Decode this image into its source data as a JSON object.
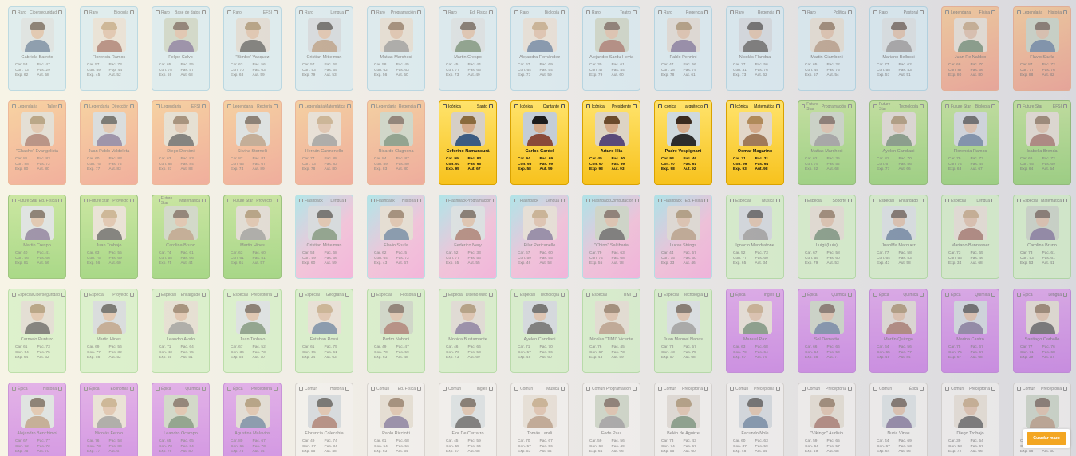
{
  "save_button": "Guardar mazo",
  "cards": [
    {
      "rarity": "Raro",
      "subject": "Ciberseguridad",
      "name": "Gabriela Barreto",
      "stats": [
        "Car. 53",
        "Pac. 47",
        "Con. 73",
        "Pas. 29",
        "Exp. 62",
        "Aut. 58"
      ]
    },
    {
      "rarity": "Raro",
      "subject": "Biología",
      "name": "Florencia Ramos",
      "stats": [
        "Car. 57",
        "Pac. 73",
        "Con. 59",
        "Pop. 44",
        "Exp. 45",
        "Aut. 52"
      ]
    },
    {
      "rarity": "Raro",
      "subject": "Base de datos",
      "name": "Felipe Calvo",
      "stats": [
        "Car. 65",
        "Pac. 55",
        "Con. 75",
        "Pas. 57",
        "Exp. 59",
        "Aut. 68"
      ]
    },
    {
      "rarity": "Raro",
      "subject": "EFSI",
      "name": "\"Bimbo\" Vasquez",
      "stats": [
        "Car. 63",
        "Pac. 56",
        "Con. 70",
        "Pas. 63",
        "Exp. 68",
        "Aut. 59"
      ]
    },
    {
      "rarity": "Raro",
      "subject": "Lengua",
      "name": "Cristian Mittelman",
      "stats": [
        "Car. 57",
        "Pac. 69",
        "Con. 53",
        "Pas. 65",
        "Exp. 79",
        "Aut. 53"
      ]
    },
    {
      "rarity": "Raro",
      "subject": "Programación",
      "name": "Matias Marchesi",
      "stats": [
        "Car. 58",
        "Pac. 45",
        "Con. 62",
        "Pas. 63",
        "Exp. 56",
        "Aut. 50"
      ]
    },
    {
      "rarity": "Raro",
      "subject": "Ed. Física",
      "name": "Martin Crespo",
      "stats": [
        "Car. 45",
        "Pac. 44",
        "Con. 77",
        "Pas. 65",
        "Exp. 73",
        "Aut. 49"
      ]
    },
    {
      "rarity": "Raro",
      "subject": "Biología",
      "name": "Alejandra Fernández",
      "stats": [
        "Car. 67",
        "Pac. 69",
        "Con. 64",
        "Pas. 54",
        "Exp. 73",
        "Aut. 59"
      ]
    },
    {
      "rarity": "Raro",
      "subject": "Teatro",
      "name": "Alejandro Sardu Hevia",
      "stats": [
        "Car. 30",
        "Pac. 61",
        "Con. 47",
        "Pas. 44",
        "Exp. 79",
        "Aut. 60"
      ]
    },
    {
      "rarity": "Raro",
      "subject": "Regencia",
      "name": "Pablo Pennini",
      "stats": [
        "Car. 47",
        "Pac. 56",
        "Con. 28",
        "Pas. 74",
        "Exp. 78",
        "Aut. 61"
      ]
    },
    {
      "rarity": "Raro",
      "subject": "Regencia",
      "name": "Nicolás Flandua",
      "stats": [
        "Car. 27",
        "Pac. 56",
        "Con. 31",
        "Pas. 76",
        "Exp. 73",
        "Aut. 62"
      ]
    },
    {
      "rarity": "Raro",
      "subject": "Política",
      "name": "Martin Giamboni",
      "stats": [
        "Car. 65",
        "Pac. 22",
        "Con. 44",
        "Pas. 75",
        "Exp. 57",
        "Aut. 54"
      ]
    },
    {
      "rarity": "Raro",
      "subject": "Pastoral",
      "name": "Mariano Bellucci",
      "stats": [
        "Car. 77",
        "Pac. 62",
        "Con. 55",
        "Pas. 43",
        "Exp. 57",
        "Aut. 51"
      ]
    },
    {
      "rarity": "Legendaria",
      "subject": "Física",
      "name": "Juan Re Naldeo",
      "stats": [
        "Car. 68",
        "Pac. 70",
        "Con. 87",
        "Pas. 66",
        "Exp. 80",
        "Aut. 80"
      ]
    },
    {
      "rarity": "Legendaria",
      "subject": "Historia",
      "name": "Flavio Sturla",
      "stats": [
        "Car. 87",
        "Pac. 72",
        "Con. 77",
        "Pas. 76",
        "Exp. 88",
        "Aut. 82"
      ]
    },
    {
      "rarity": "Legendaria",
      "subject": "Taller",
      "name": "\"Chacho\" Evangelista",
      "stats": [
        "Car. 81",
        "Pac. 83",
        "Con. 88",
        "Pas. 72",
        "Exp. 80",
        "Aut. 80"
      ]
    },
    {
      "rarity": "Legendaria",
      "subject": "Dirección",
      "name": "Juan Pablo Valdeleta",
      "stats": [
        "Car. 60",
        "Pac. 83",
        "Con. 75",
        "Pas. 72",
        "Exp. 77",
        "Aut. 83"
      ]
    },
    {
      "rarity": "Legendaria",
      "subject": "EFSI",
      "name": "Diego Dersimi",
      "stats": [
        "Car. 63",
        "Pac. 83",
        "Con. 88",
        "Pas. 84",
        "Exp. 87",
        "Aut. 83"
      ]
    },
    {
      "rarity": "Legendaria",
      "subject": "Rectoría",
      "name": "Silvina Stornelli",
      "stats": [
        "Car. 87",
        "Pac. 81",
        "Con. 65",
        "Pas. 67",
        "Exp. 74",
        "Aut. 89"
      ]
    },
    {
      "rarity": "Legendaria",
      "subject": "Matemática",
      "name": "Hernán Carmenello",
      "stats": [
        "Car. 77",
        "Pac. 88",
        "Con. 73",
        "Pas. 83",
        "Exp. 78",
        "Aut. 80"
      ]
    },
    {
      "rarity": "Legendaria",
      "subject": "Regencia",
      "name": "Ricardo Clagnona",
      "stats": [
        "Car. 84",
        "Pac. 87",
        "Con. 89",
        "Pas. 80",
        "Exp. 83",
        "Aut. 80"
      ]
    },
    {
      "rarity": "Icónica",
      "subject": "Santo",
      "name": "Ceferino Namuncurá",
      "stats": [
        "Car. 99",
        "Pac. 93",
        "Con. 91",
        "Pas. 96",
        "Exp. 95",
        "Aut. 67"
      ]
    },
    {
      "rarity": "Icónica",
      "subject": "Cantante",
      "name": "Carlos Gardel",
      "stats": [
        "Car. 94",
        "Pac. 69",
        "Con. 93",
        "Pas. 99",
        "Exp. 58",
        "Aut. 59"
      ]
    },
    {
      "rarity": "Icónica",
      "subject": "Presidente",
      "name": "Arturo Illia",
      "stats": [
        "Car. 45",
        "Pac. 90",
        "Con. 67",
        "Pas. 99",
        "Exp. 93",
        "Aut. 93"
      ]
    },
    {
      "rarity": "Icónica",
      "subject": "arquitecto",
      "name": "Padre Vespignani",
      "stats": [
        "Car. 93",
        "Pac. 46",
        "Con. 97",
        "Pas. 91",
        "Exp. 98",
        "Aut. 92"
      ]
    },
    {
      "rarity": "Icónica",
      "subject": "Matemática",
      "name": "Osmar Magarino",
      "stats": [
        "Car. 71",
        "Pac. 31",
        "Con. 99",
        "Pas. 94",
        "Exp. 93",
        "Aut. 98"
      ]
    },
    {
      "rarity": "Future Star",
      "subject": "Programación",
      "name": "Matias Marchesi",
      "stats": [
        "Car. 62",
        "Pac. 35",
        "Con. 75",
        "Pas. 52",
        "Exp. 82",
        "Aut. 68"
      ]
    },
    {
      "rarity": "Future Star",
      "subject": "Tecnología",
      "name": "Ayelen Candiani",
      "stats": [
        "Car. 81",
        "Pac. 70",
        "Con. 67",
        "Pas. 56",
        "Exp. 77",
        "Aut. 66"
      ]
    },
    {
      "rarity": "Future Star",
      "subject": "Biología",
      "name": "Florencia Ramos",
      "stats": [
        "Car. 79",
        "Pac. 73",
        "Con. 74",
        "Pas. 44",
        "Exp. 63",
        "Aut. 67"
      ]
    },
    {
      "rarity": "Future Star",
      "subject": "EFSI",
      "name": "Isabella Brenda",
      "stats": [
        "Car. 66",
        "Pac. 72",
        "Con. 65",
        "Pas. 69",
        "Exp. 64",
        "Aut. 54"
      ]
    },
    {
      "rarity": "Future Star",
      "subject": "Ed. Física",
      "name": "Martin Crespo",
      "stats": [
        "Car. 40",
        "Pac. 41",
        "Con. 56",
        "Pas. 66",
        "Exp. 81",
        "Aut. 56"
      ]
    },
    {
      "rarity": "Future Star",
      "subject": "Proyecto",
      "name": "Juan Trobajo",
      "stats": [
        "Car. 63",
        "Pac. 55",
        "Con. 75",
        "Pas. 69",
        "Exp. 56",
        "Aut. 60"
      ]
    },
    {
      "rarity": "Future Star",
      "subject": "Matemática",
      "name": "Carolina Bruno",
      "stats": [
        "Car. 74",
        "Pac. 61",
        "Con. 55",
        "Pas. 66",
        "Exp. 75",
        "Aut. 44"
      ]
    },
    {
      "rarity": "Future Star",
      "subject": "Proyecto",
      "name": "Martin Hines",
      "stats": [
        "Car. 63",
        "Pac. 60",
        "Con. 61",
        "Pas. 51",
        "Exp. 61",
        "Aut. 57"
      ]
    },
    {
      "rarity": "Flashback",
      "subject": "Lengua",
      "name": "Cristian Mittelman",
      "stats": [
        "Car. 53",
        "Pac. 68",
        "Con. 59",
        "Pas. 66",
        "Exp. 60",
        "Aut. 59"
      ]
    },
    {
      "rarity": "Flashback",
      "subject": "Historia",
      "name": "Flavio Sturla",
      "stats": [
        "Car. 62",
        "Pac. 5",
        "Con. 64",
        "Pas. 72",
        "Exp. 43",
        "Aut. 67"
      ]
    },
    {
      "rarity": "Flashback",
      "subject": "Programación",
      "name": "Federico Nery",
      "stats": [
        "Car. 52",
        "Pac. 33",
        "Con. 77",
        "Pas. 56",
        "Exp. 55",
        "Aut. 55"
      ]
    },
    {
      "rarity": "Flashback",
      "subject": "Lengua",
      "name": "Pilar Pericanelle",
      "stats": [
        "Car. 67",
        "Pac. 60",
        "Con. 59",
        "Pas. 55",
        "Exp. 46",
        "Aut. 58"
      ]
    },
    {
      "rarity": "Flashback",
      "subject": "Computación",
      "name": "\"Chino\" Saltibaria",
      "stats": [
        "Car. 79",
        "Pac. 63",
        "Con. 74",
        "Pas. 68",
        "Exp. 55",
        "Aut. 78"
      ]
    },
    {
      "rarity": "Flashback",
      "subject": "Ed. Física",
      "name": "Lucas Strings",
      "stats": [
        "Car. 44",
        "Pac. 57",
        "Con. 75",
        "Pas. 60",
        "Exp. 33",
        "Aut. 46"
      ]
    },
    {
      "rarity": "Especial",
      "subject": "Música",
      "name": "Ignacio Mendrafone",
      "stats": [
        "Car. 52",
        "Pac. 73",
        "Con. 77",
        "Pas. 60",
        "Exp. 65",
        "Aut. 34"
      ]
    },
    {
      "rarity": "Especial",
      "subject": "Soporte",
      "name": "Luigi (Luis)",
      "stats": [
        "Car. 67",
        "Pac. 58",
        "Con. 55",
        "Pas. 60",
        "Exp. 79",
        "Aut. 53"
      ]
    },
    {
      "rarity": "Especial",
      "subject": "Encargado",
      "name": "JuanMa Marquez",
      "stats": [
        "Car. 77",
        "Pac. 58",
        "Con. 64",
        "Pas. 53",
        "Exp. 43",
        "Aut. 58"
      ]
    },
    {
      "rarity": "Especial",
      "subject": "Lengua",
      "name": "Mariano Bennasser",
      "stats": [
        "Car. 73",
        "Pac. 65",
        "Con. 56",
        "Pas. 46",
        "Exp. 34",
        "Aut. 68"
      ]
    },
    {
      "rarity": "Especial",
      "subject": "Matemática",
      "name": "Carolina Bruno",
      "stats": [
        "Car. 73",
        "Pac. 61",
        "Con. 53",
        "Pas. 61",
        "Exp. 53",
        "Aut. 41"
      ]
    },
    {
      "rarity": "Especial",
      "subject": "Ciberseguridad",
      "name": "Carmelo Punturo",
      "stats": [
        "Car. 61",
        "Pac. 73",
        "Con. 54",
        "Pas. 75",
        "Exp. 64",
        "Aut. 62"
      ]
    },
    {
      "rarity": "Especial",
      "subject": "Proyecto",
      "name": "Martin Hines",
      "stats": [
        "Car. 69",
        "Pac. 56",
        "Con. 77",
        "Pas. 32",
        "Exp. 58",
        "Aut. 52"
      ]
    },
    {
      "rarity": "Especial",
      "subject": "Encargado",
      "name": "Leandro Avalo",
      "stats": [
        "Car. 71",
        "Pac. 64",
        "Con. 43",
        "Pas. 75",
        "Exp. 55",
        "Aut. 51"
      ]
    },
    {
      "rarity": "Especial",
      "subject": "Preceptoría",
      "name": "Juan Trobajo",
      "stats": [
        "Car. 67",
        "Pac. 52",
        "Con. 36",
        "Pas. 73",
        "Exp. 58",
        "Aut. 70"
      ]
    },
    {
      "rarity": "Especial",
      "subject": "Geografía",
      "name": "Esteban Rossi",
      "stats": [
        "Car. 61",
        "Pac. 75",
        "Con. 55",
        "Pas. 61",
        "Exp. 34",
        "Aut. 63"
      ]
    },
    {
      "rarity": "Especial",
      "subject": "Filosofía",
      "name": "Pedro Naboni",
      "stats": [
        "Car. 49",
        "Pac. 47",
        "Con. 70",
        "Pas. 59",
        "Exp. 63",
        "Aut. 48"
      ]
    },
    {
      "rarity": "Especial",
      "subject": "Diseño Web",
      "name": "Monica Bustamante",
      "stats": [
        "Car. 46",
        "Pac. 66",
        "Con. 76",
        "Pas. 53",
        "Exp. 73",
        "Aut. 69"
      ]
    },
    {
      "rarity": "Especial",
      "subject": "Tecnología",
      "name": "Ayelen Candiani",
      "stats": [
        "Car. 71",
        "Pac. 70",
        "Con. 57",
        "Pas. 56",
        "Exp. 48",
        "Aut. 60"
      ]
    },
    {
      "rarity": "Especial",
      "subject": "TIMI",
      "name": "Nicolás \"TIMI\" Vicente",
      "stats": [
        "Car. 76",
        "Pac. 45",
        "Con. 67",
        "Pas. 73",
        "Exp. 43",
        "Aut. 59"
      ]
    },
    {
      "rarity": "Especial",
      "subject": "Tecnología",
      "name": "Juan Manuel Nahas",
      "stats": [
        "Car. 73",
        "Pac. 57",
        "Con. 43",
        "Pas. 75",
        "Exp. 57",
        "Aut. 68"
      ]
    },
    {
      "rarity": "Épica",
      "subject": "Inglés",
      "name": "Manuel Paz",
      "stats": [
        "Car. 63",
        "Pac. 68",
        "Con. 79",
        "Pas. 64",
        "Exp. 67",
        "Aut. 79"
      ]
    },
    {
      "rarity": "Épica",
      "subject": "Química",
      "name": "Sol Demattio",
      "stats": [
        "Car. 66",
        "Pac. 66",
        "Con. 64",
        "Pas. 50",
        "Exp. 58",
        "Aut. 77"
      ]
    },
    {
      "rarity": "Épica",
      "subject": "Química",
      "name": "Martín Quiroga",
      "stats": [
        "Car. 64",
        "Pac. 56",
        "Con. 65",
        "Pas. 77",
        "Exp. 49",
        "Aut. 84"
      ]
    },
    {
      "rarity": "Épica",
      "subject": "Química",
      "name": "Marina Castro",
      "stats": [
        "Car. 75",
        "Pac. 67",
        "Con. 75",
        "Pas. 67",
        "Exp. 67",
        "Aut. 68"
      ]
    },
    {
      "rarity": "Épica",
      "subject": "Lengua",
      "name": "Santiago Carballo",
      "stats": [
        "Car. 77",
        "Pac. 76",
        "Con. 71",
        "Pas. 68",
        "Exp. 39",
        "Aut. 67"
      ]
    },
    {
      "rarity": "Épica",
      "subject": "Historia",
      "name": "Alejandro Benchimol",
      "stats": [
        "Car. 67",
        "Pac. 77",
        "Con. 72",
        "Pas. 72",
        "Exp. 75",
        "Aut. 70"
      ]
    },
    {
      "rarity": "Épica",
      "subject": "Economía",
      "name": "Nicolás Ferolo",
      "stats": [
        "Car. 76",
        "Pac. 58",
        "Con. 73",
        "Pas. 80",
        "Exp. 77",
        "Aut. 67"
      ]
    },
    {
      "rarity": "Épica",
      "subject": "Química",
      "name": "Leandro Ocampo",
      "stats": [
        "Car. 65",
        "Pac. 65",
        "Con. 73",
        "Pas. 64",
        "Exp. 76",
        "Aut. 80"
      ]
    },
    {
      "rarity": "Épica",
      "subject": "Preceptoría",
      "name": "Agustina Malavios",
      "stats": [
        "Car. 80",
        "Pac. 67",
        "Con. 65",
        "Pas. 73",
        "Exp. 75",
        "Aut. 74"
      ]
    },
    {
      "rarity": "Común",
      "subject": "Historia",
      "name": "Florencia Colecchia",
      "stats": [
        "Car. 49",
        "Pac. 74",
        "Con. 67",
        "Pas. 34",
        "Exp. 55",
        "Aut. 48"
      ]
    },
    {
      "rarity": "Común",
      "subject": "Ed. Física",
      "name": "Pablo Ricciotti",
      "stats": [
        "Car. 61",
        "Pac. 68",
        "Con. 54",
        "Pas. 56",
        "Exp. 63",
        "Aut. 54"
      ]
    },
    {
      "rarity": "Común",
      "subject": "Inglés",
      "name": "Flor De Cerrarro",
      "stats": [
        "Car. 45",
        "Pac. 59",
        "Con. 55",
        "Pas. 64",
        "Exp. 57",
        "Aut. 68"
      ]
    },
    {
      "rarity": "Común",
      "subject": "Música",
      "name": "Tomás Landi",
      "stats": [
        "Car. 70",
        "Pac. 67",
        "Con. 57",
        "Pas. 56",
        "Exp. 53",
        "Aut. 54"
      ]
    },
    {
      "rarity": "Común",
      "subject": "Programación",
      "name": "Fede Paul",
      "stats": [
        "Car. 59",
        "Pac. 56",
        "Con. 68",
        "Pas. 49",
        "Exp. 64",
        "Aut. 66"
      ]
    },
    {
      "rarity": "Común",
      "subject": "Preceptoría",
      "name": "Belén de Aguirre",
      "stats": [
        "Car. 73",
        "Pac. 43",
        "Con. 74",
        "Pas. 67",
        "Exp. 55",
        "Aut. 60"
      ]
    },
    {
      "rarity": "Común",
      "subject": "Preceptoría",
      "name": "Facundo Nole",
      "stats": [
        "Car. 60",
        "Pac. 63",
        "Con. 37",
        "Pas. 59",
        "Exp. 48",
        "Aut. 54"
      ]
    },
    {
      "rarity": "Común",
      "subject": "Preceptoría",
      "name": "\"Vikingo\" Audisio",
      "stats": [
        "Car. 59",
        "Pac. 65",
        "Con. 64",
        "Pas. 57",
        "Exp. 49",
        "Aut. 68"
      ]
    },
    {
      "rarity": "Común",
      "subject": "Ética",
      "name": "Nuria Vinas",
      "stats": [
        "Car. 44",
        "Pac. 69",
        "Con. 67",
        "Pas. 53",
        "Exp. 64",
        "Aut. 56"
      ]
    },
    {
      "rarity": "Común",
      "subject": "Preceptoría",
      "name": "Diego Trobajo",
      "stats": [
        "Car. 39",
        "Pac. 54",
        "Con. 58",
        "Pas. 67",
        "Exp. 72",
        "Aut. 66"
      ]
    },
    {
      "rarity": "Común",
      "subject": "Preceptoría",
      "name": "Seba",
      "stats": [
        "Car. 38",
        "Pac. 61",
        "Con. 52",
        "Pas. 74",
        "Exp. 58",
        "Aut. 60"
      ]
    }
  ],
  "highlight": [
    21,
    22,
    23,
    24,
    25
  ],
  "colors": {
    "accent": "#f3a622",
    "raro": "#cfe9f4",
    "legendaria": "#ef7a62",
    "iconica": "#f7c21d",
    "future": "#6cc43c",
    "flashback": "#f78bd2",
    "especial": "#c9efb8",
    "epica": "#b94fe0",
    "comun": "#f4f2f0"
  }
}
